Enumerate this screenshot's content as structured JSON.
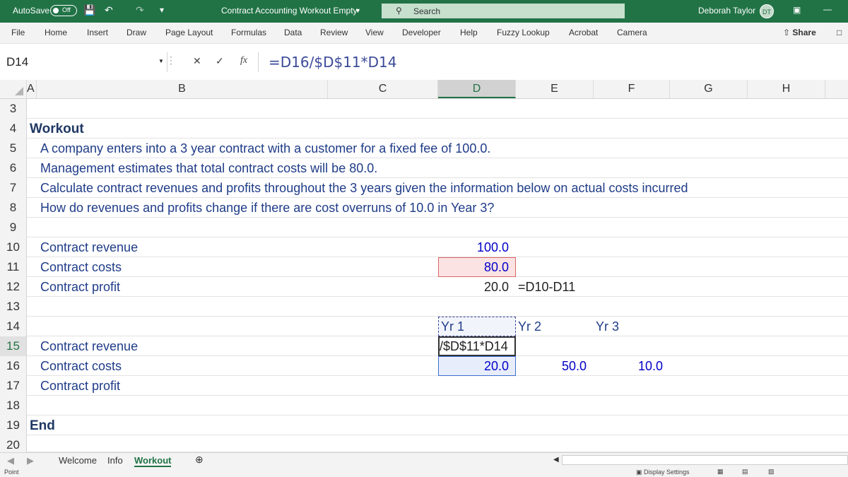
{
  "titlebar": {
    "autosave_label": "AutoSave",
    "autosave_state": "Off",
    "doc_title": "Contract Accounting Workout Empty",
    "search_placeholder": "Search",
    "user_name": "Deborah Taylor",
    "user_initials": "DT"
  },
  "ribbon": {
    "tabs": [
      "File",
      "Home",
      "Insert",
      "Draw",
      "Page Layout",
      "Formulas",
      "Data",
      "Review",
      "View",
      "Developer",
      "Help",
      "Fuzzy Lookup",
      "Acrobat",
      "Camera"
    ],
    "share_label": "Share"
  },
  "formula_bar": {
    "name_box": "D14",
    "fx_label": "fx",
    "formula": "=D16/$D$11*D14"
  },
  "columns": [
    "A",
    "B",
    "C",
    "D",
    "E",
    "F",
    "G",
    "H"
  ],
  "rows": [
    {
      "n": "3"
    },
    {
      "n": "4",
      "a": "Workout"
    },
    {
      "n": "5",
      "b": "A company enters into a 3 year contract with a customer for a fixed fee of 100.0."
    },
    {
      "n": "6",
      "b": "Management estimates that total contract costs will be 80.0."
    },
    {
      "n": "7",
      "b": "Calculate contract revenues and profits throughout the 3 years given the information below on actual costs incurred"
    },
    {
      "n": "8",
      "b": "How do revenues and profits change if there are cost overruns of 10.0 in Year 3?"
    },
    {
      "n": "9"
    },
    {
      "n": "10",
      "b": "Contract revenue",
      "d": "100.0"
    },
    {
      "n": "11",
      "b": "Contract costs",
      "d": "80.0"
    },
    {
      "n": "12",
      "b": "Contract profit",
      "d": "20.0",
      "e": "=D10-D11"
    },
    {
      "n": "13"
    },
    {
      "n": "14",
      "d": "Yr 1",
      "e": "Yr 2",
      "f": "Yr 3"
    },
    {
      "n": "15",
      "b": "Contract revenue",
      "d": "/$D$11*D14"
    },
    {
      "n": "16",
      "b": "Contract costs",
      "d": "20.0",
      "e": "50.0",
      "f": "10.0"
    },
    {
      "n": "17",
      "b": "Contract profit"
    },
    {
      "n": "18"
    },
    {
      "n": "19",
      "a": "End"
    },
    {
      "n": "20"
    }
  ],
  "sheets": [
    "Welcome",
    "Info",
    "Workout"
  ],
  "active_sheet": "Workout",
  "status": {
    "mode": "Point",
    "display_settings": "Display Settings"
  },
  "colors": {
    "accent": "#217346",
    "input_blue": "#0000c8",
    "text_blue": "#1f3c88"
  }
}
